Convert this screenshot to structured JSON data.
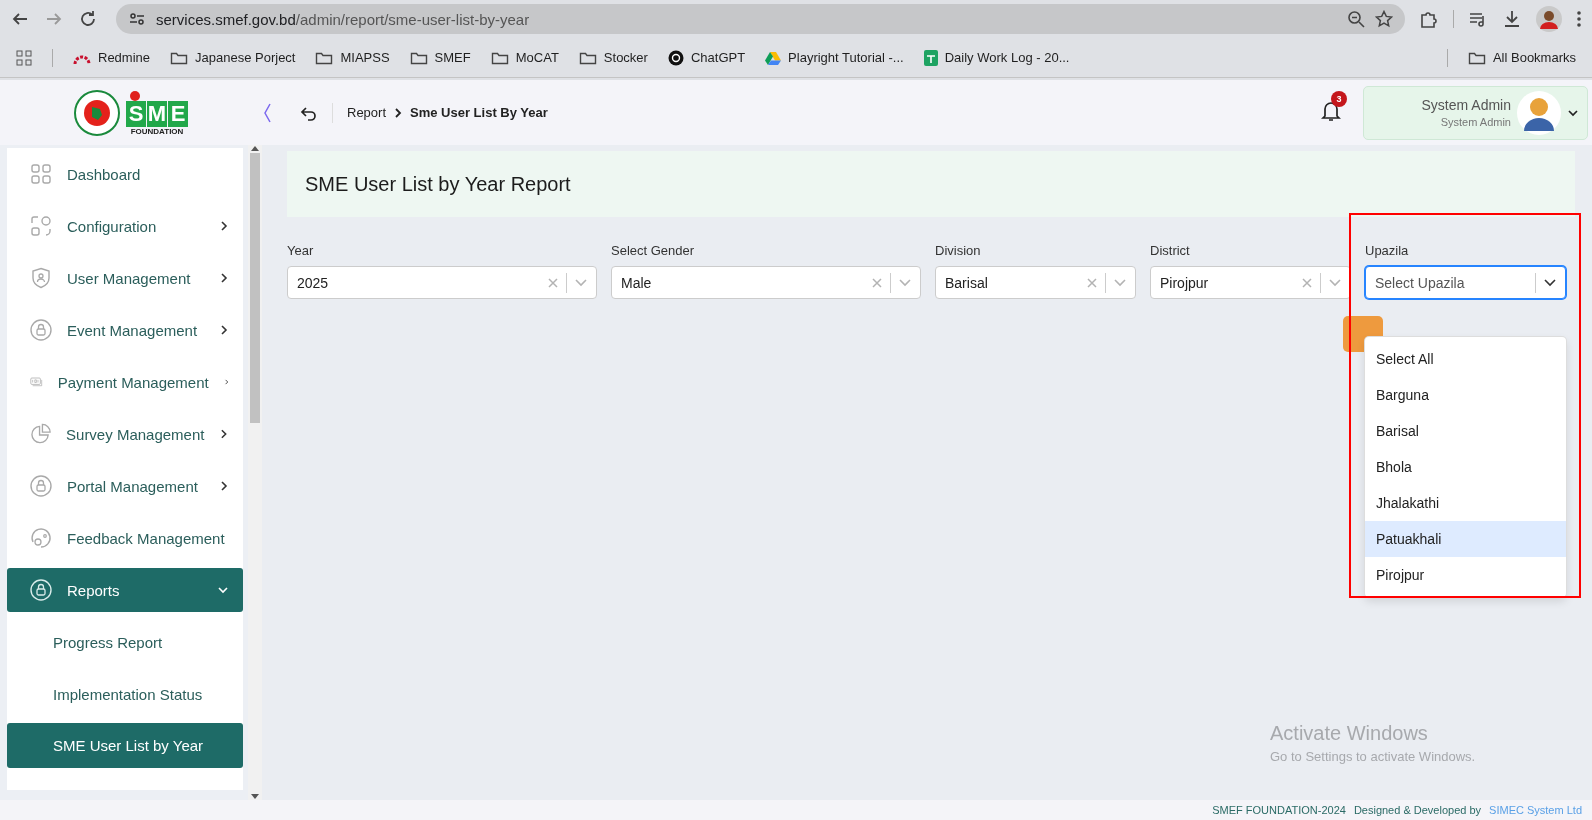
{
  "browser": {
    "url_host": "services.smef.gov.bd",
    "url_path": "/admin/report/sme-user-list-by-year",
    "bookmarks": [
      {
        "kind": "redmine",
        "label": "Redmine"
      },
      {
        "kind": "folder",
        "label": "Japanese Porject"
      },
      {
        "kind": "folder",
        "label": "MIAPSS"
      },
      {
        "kind": "folder",
        "label": "SMEF"
      },
      {
        "kind": "folder",
        "label": "MoCAT"
      },
      {
        "kind": "folder",
        "label": "Stocker"
      },
      {
        "kind": "chatgpt",
        "label": "ChatGPT"
      },
      {
        "kind": "drive",
        "label": "Playright Tutorial -..."
      },
      {
        "kind": "sheets",
        "label": "Daily Work Log - 20..."
      }
    ],
    "all_bookmarks": "All Bookmarks"
  },
  "header": {
    "logo": {
      "letters": "SME",
      "subtitle": "FOUNDATION"
    },
    "breadcrumb": {
      "parent": "Report",
      "current": "Sme User List By Year"
    },
    "notifications": "3",
    "user": {
      "name": "System Admin",
      "role": "System Admin"
    }
  },
  "sidebar": {
    "items": [
      {
        "label": "Dashboard",
        "kind": "link",
        "selected": false
      },
      {
        "label": "Configuration",
        "kind": "group",
        "expanded": false,
        "selected": false
      },
      {
        "label": "User Management",
        "kind": "group",
        "expanded": false,
        "selected": false
      },
      {
        "label": "Event Management",
        "kind": "group",
        "expanded": false,
        "selected": false
      },
      {
        "label": "Payment Management",
        "kind": "group",
        "expanded": false,
        "selected": false
      },
      {
        "label": "Survey Management",
        "kind": "group",
        "expanded": false,
        "selected": false
      },
      {
        "label": "Portal Management",
        "kind": "group",
        "expanded": false,
        "selected": false
      },
      {
        "label": "Feedback Management",
        "kind": "link",
        "selected": false
      },
      {
        "label": "Reports",
        "kind": "group",
        "expanded": true,
        "selected": true,
        "children": [
          {
            "label": "Progress Report",
            "selected": false
          },
          {
            "label": "Implementation Status",
            "selected": false
          },
          {
            "label": "SME User List by Year",
            "selected": true
          }
        ]
      }
    ]
  },
  "page": {
    "title": "SME User List by Year Report",
    "filters": [
      {
        "label": "Year",
        "value": "2025",
        "clearable": true,
        "focused": false
      },
      {
        "label": "Select Gender",
        "value": "Male",
        "clearable": true,
        "focused": false
      },
      {
        "label": "Division",
        "value": "Barisal",
        "clearable": true,
        "focused": false
      },
      {
        "label": "District",
        "value": "Pirojpur",
        "clearable": true,
        "focused": false
      },
      {
        "label": "Upazila",
        "placeholder": "Select Upazila",
        "clearable": false,
        "focused": true
      }
    ],
    "dropdown": {
      "options": [
        {
          "label": "Select All",
          "selected": false
        },
        {
          "label": "Barguna",
          "selected": false
        },
        {
          "label": "Barisal",
          "selected": false
        },
        {
          "label": "Bhola",
          "selected": false
        },
        {
          "label": "Jhalakathi",
          "selected": false
        },
        {
          "label": "Patuakhali",
          "selected": true
        },
        {
          "label": "Pirojpur",
          "selected": false
        }
      ]
    }
  },
  "os_notice": {
    "title": "Activate Windows",
    "text": "Go to Settings to activate Windows."
  },
  "footer": {
    "copyright": "SMEF FOUNDATION-2024",
    "credit": "Designed & Developed by",
    "company": "SIMEC System Ltd"
  }
}
